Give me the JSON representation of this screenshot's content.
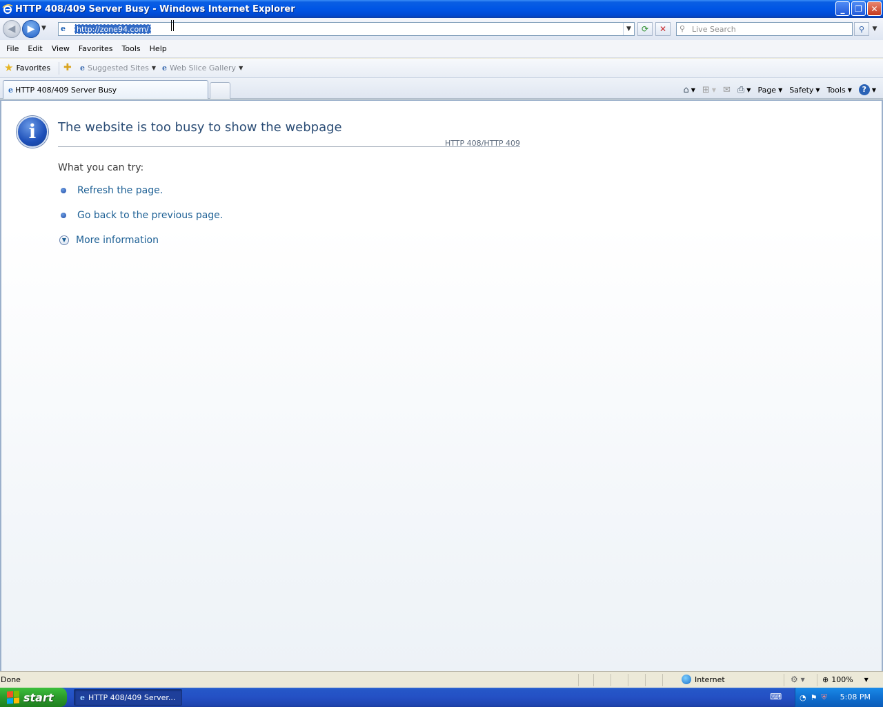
{
  "window": {
    "title": "HTTP 408/409 Server Busy - Windows Internet Explorer",
    "controls": {
      "minimize": "_",
      "maximize": "❐",
      "close": "✕"
    }
  },
  "address_bar": {
    "url": "http://zone94.com/",
    "search_placeholder": "Live Search"
  },
  "menu": [
    "File",
    "Edit",
    "View",
    "Favorites",
    "Tools",
    "Help"
  ],
  "favorites_bar": {
    "favorites_label": "Favorites",
    "links": [
      "Suggested Sites",
      "Web Slice Gallery"
    ]
  },
  "tab": {
    "title": "HTTP 408/409 Server Busy"
  },
  "command_bar": {
    "page": "Page",
    "safety": "Safety",
    "tools": "Tools"
  },
  "error_page": {
    "headline": "The website is too busy to show the webpage",
    "code": "HTTP 408/HTTP 409",
    "try_label": "What you can try:",
    "options": [
      "Refresh the page.",
      "Go back to the previous page."
    ],
    "more_info": "More information"
  },
  "status_bar": {
    "status": "Done",
    "zone": "Internet",
    "zoom": "100%"
  },
  "taskbar": {
    "start_label": "start",
    "task_item": "HTTP 408/409 Server...",
    "clock": "5:08 PM"
  },
  "colors": {
    "title_bar": "#0055e5",
    "link": "#1c5f94",
    "headline": "#2a4c75",
    "taskbar": "#2450c4",
    "start_button": "#2b9a2b"
  },
  "icons": [
    "ie-logo-icon",
    "back-icon",
    "forward-icon",
    "refresh-icon",
    "stop-icon",
    "search-icon",
    "star-icon",
    "add-favorite-icon",
    "home-icon",
    "feeds-icon",
    "mail-icon",
    "print-icon",
    "help-icon",
    "info-icon",
    "globe-icon",
    "zoom-icon",
    "windows-flag-icon"
  ]
}
